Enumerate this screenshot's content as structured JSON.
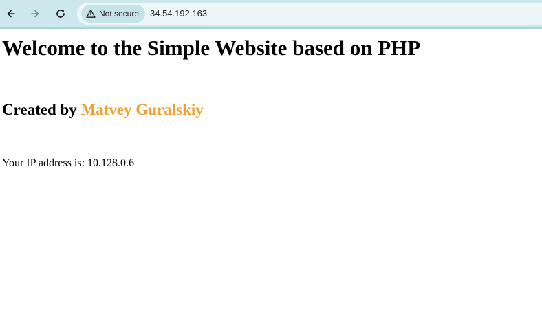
{
  "browser": {
    "security_label": "Not secure",
    "url": "34.54.192.163",
    "icons": {
      "back": "arrow-left-icon",
      "forward": "arrow-right-icon",
      "reload": "reload-icon",
      "security": "warning-triangle-icon"
    }
  },
  "page": {
    "title": "Welcome to the Simple Website based on PHP",
    "created_by_prefix": "Created by ",
    "author": "Matvey Guralskiy",
    "ip_text": "Your IP address is: 10.128.0.6"
  },
  "colors": {
    "toolbar_bg": "#cde8ec",
    "author_accent": "#f0a030"
  }
}
